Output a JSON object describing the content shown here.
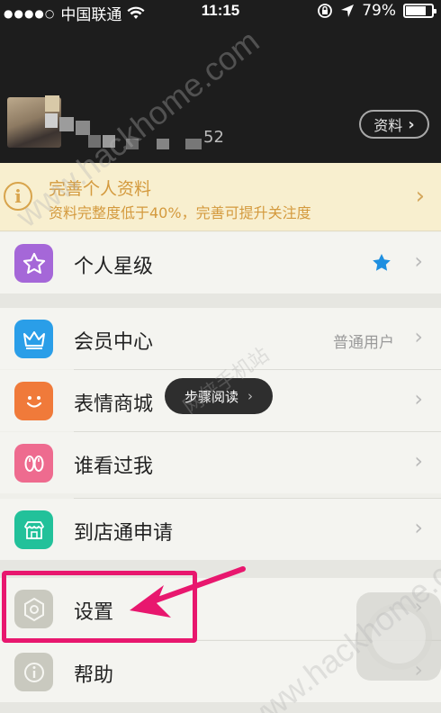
{
  "status_bar": {
    "carrier": "中国联通",
    "time": "11:15",
    "battery_text": "79%",
    "battery_level": 0.79
  },
  "profile": {
    "uid_suffix": "52",
    "profile_button_label": "资料",
    "chevron": "›"
  },
  "notice": {
    "title": "完善个人资料",
    "subtitle": "资料完整度低于40%，完善可提升关注度",
    "icon": "info-icon"
  },
  "menu": {
    "star_level": {
      "label": "个人星级",
      "icon": "star-icon",
      "color": "#a567d8"
    },
    "vip_center": {
      "label": "会员中心",
      "value": "普通用户",
      "icon": "crown-icon",
      "color": "#2a9ee8"
    },
    "emoji_shop": {
      "label": "表情商城",
      "icon": "smiley-icon",
      "color": "#f07a3a"
    },
    "visitors": {
      "label": "谁看过我",
      "icon": "footprint-icon",
      "color": "#ee6b8f"
    },
    "store_apply": {
      "label": "到店通申请",
      "icon": "store-icon",
      "color": "#22c19a"
    },
    "settings": {
      "label": "设置",
      "icon": "hexagon-gear-icon",
      "color": "#c9c9bf"
    },
    "help": {
      "label": "帮助",
      "icon": "info-circle-icon",
      "color": "#c9c9bf"
    }
  },
  "tooltip": {
    "label": "步骤阅读"
  },
  "watermarks": {
    "site": "www.hackhome.com",
    "cn": "网侠手机站"
  },
  "colors": {
    "highlight": "#e8176e",
    "notice_text": "#d49a3e",
    "star": "#1e8fe0"
  }
}
